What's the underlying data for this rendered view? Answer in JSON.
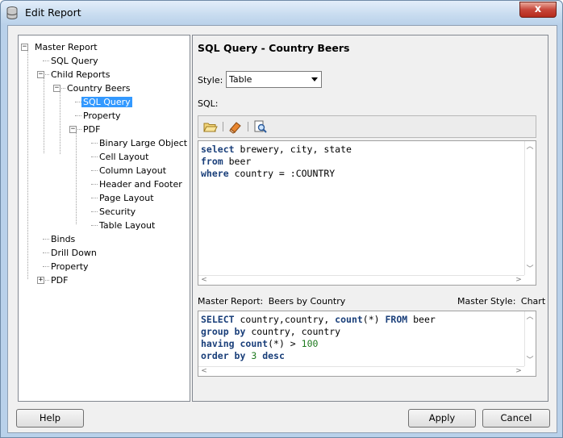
{
  "window": {
    "title": "Edit Report",
    "close_label": "x"
  },
  "tree": {
    "items": [
      {
        "label": "Master Report",
        "expander": "−"
      },
      {
        "label": "SQL Query"
      },
      {
        "label": "Child Reports",
        "expander": "−"
      },
      {
        "label": "Country Beers",
        "expander": "−"
      },
      {
        "label": "SQL Query",
        "selected": true
      },
      {
        "label": "Property"
      },
      {
        "label": "PDF",
        "expander": "−"
      },
      {
        "label": "Binary Large Object"
      },
      {
        "label": "Cell Layout"
      },
      {
        "label": "Column Layout"
      },
      {
        "label": "Header and Footer"
      },
      {
        "label": "Page Layout"
      },
      {
        "label": "Security"
      },
      {
        "label": "Table Layout"
      },
      {
        "label": "Binds"
      },
      {
        "label": "Drill Down"
      },
      {
        "label": "Property"
      },
      {
        "label": "PDF",
        "expander": "+"
      }
    ]
  },
  "panel": {
    "heading": "SQL Query - Country Beers",
    "style_label": "Style:",
    "style_value": "Table",
    "sql_label": "SQL:",
    "toolbar_icons": [
      "open-folder-icon",
      "eraser-icon",
      "find-icon"
    ],
    "sql_lines": [
      [
        {
          "t": "select",
          "k": "kw"
        },
        {
          "t": " brewery, city, state"
        }
      ],
      [
        {
          "t": "from",
          "k": "kw"
        },
        {
          "t": " beer"
        }
      ],
      [
        {
          "t": "where",
          "k": "kw"
        },
        {
          "t": " country = :COUNTRY"
        }
      ]
    ],
    "master_report_label": "Master Report:",
    "master_report_value": "Beers by Country",
    "master_style_label": "Master Style:",
    "master_style_value": "Chart",
    "master_sql_lines": [
      [
        {
          "t": "SELECT",
          "k": "kw"
        },
        {
          "t": " country,country, "
        },
        {
          "t": "count",
          "k": "kw"
        },
        {
          "t": "(*) "
        },
        {
          "t": "FROM",
          "k": "kw"
        },
        {
          "t": " beer"
        }
      ],
      [
        {
          "t": "group by",
          "k": "kw"
        },
        {
          "t": " country, country"
        }
      ],
      [
        {
          "t": "having",
          "k": "kw"
        },
        {
          "t": " "
        },
        {
          "t": "count",
          "k": "kw"
        },
        {
          "t": "(*) > "
        },
        {
          "t": "100",
          "k": "num"
        }
      ],
      [
        {
          "t": "order by",
          "k": "kw"
        },
        {
          "t": " "
        },
        {
          "t": "3",
          "k": "num"
        },
        {
          "t": " "
        },
        {
          "t": "desc",
          "k": "kw"
        }
      ]
    ]
  },
  "buttons": {
    "help": "Help",
    "apply": "Apply",
    "cancel": "Cancel"
  },
  "colors": {
    "selection": "#3399ff",
    "keyword": "#1a3f7a",
    "number": "#1d7a1d"
  }
}
